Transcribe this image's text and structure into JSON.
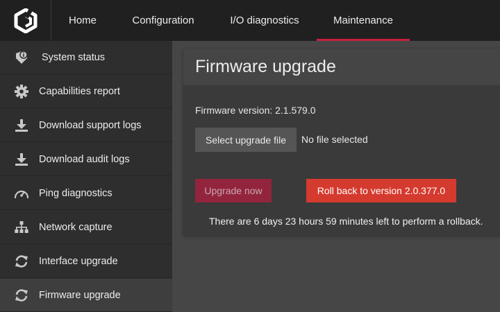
{
  "nav": {
    "items": [
      {
        "label": "Home"
      },
      {
        "label": "Configuration"
      },
      {
        "label": "I/O diagnostics"
      },
      {
        "label": "Maintenance",
        "active": true
      }
    ],
    "accent_color": "#c8203e"
  },
  "sidebar": {
    "items": [
      {
        "label": "System status",
        "icon": "shield-info-icon"
      },
      {
        "label": "Capabilities report",
        "icon": "gear-icon"
      },
      {
        "label": "Download support logs",
        "icon": "download-icon"
      },
      {
        "label": "Download audit logs",
        "icon": "download-icon"
      },
      {
        "label": "Ping diagnostics",
        "icon": "gauge-icon"
      },
      {
        "label": "Network capture",
        "icon": "network-icon"
      },
      {
        "label": "Interface upgrade",
        "icon": "refresh-icon"
      },
      {
        "label": "Firmware upgrade",
        "icon": "refresh-icon",
        "active": true
      }
    ]
  },
  "main": {
    "title": "Firmware upgrade",
    "firmware_version_text": "Firmware version: 2.1.579.0",
    "select_file_label": "Select upgrade file",
    "no_file_text": "No file selected",
    "upgrade_now_label": "Upgrade now",
    "rollback_label": "Roll back to version 2.0.377.0",
    "rollback_note": "There are 6 days 23 hours 59 minutes left to perform a rollback."
  },
  "colors": {
    "upgrade_disabled": "#93243e",
    "rollback": "#d53a2e"
  }
}
